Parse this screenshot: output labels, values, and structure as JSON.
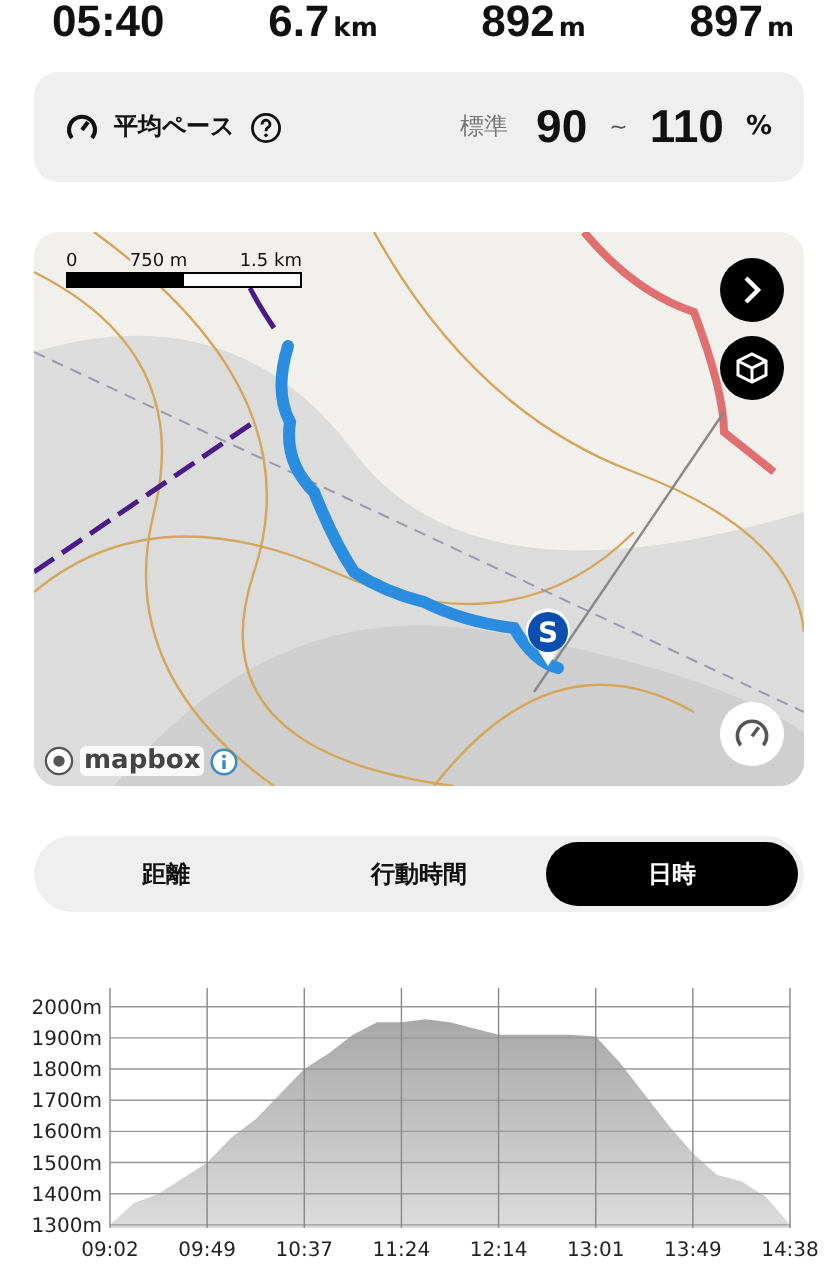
{
  "stats": [
    {
      "value": "05:40"
    },
    {
      "value": "6.7",
      "unit": "km"
    },
    {
      "value": "892",
      "unit": "m"
    },
    {
      "value": "897",
      "unit": "m"
    }
  ],
  "pace": {
    "label": "平均ペース",
    "standard_label": "標準",
    "min": "90",
    "separator": "~",
    "max": "110",
    "unit": "%"
  },
  "map": {
    "kind": "picture",
    "scale": {
      "labels": [
        "0",
        "750 m",
        "1.5 km"
      ]
    },
    "attribution": "mapbox",
    "start_marker": "S"
  },
  "tabs": [
    {
      "label": "距離",
      "selected": false
    },
    {
      "label": "行動時間",
      "selected": false
    },
    {
      "label": "日時",
      "selected": true
    }
  ],
  "chart_data": {
    "type": "area",
    "grid": true,
    "ylim": [
      1290,
      2060
    ],
    "categories": [
      "09:02",
      null,
      null,
      null,
      "09:49",
      null,
      null,
      null,
      "10:37",
      null,
      null,
      null,
      "11:24",
      null,
      null,
      null,
      "12:14",
      null,
      null,
      null,
      "13:01",
      null,
      null,
      null,
      "13:49",
      null,
      null,
      null,
      "14:38"
    ],
    "series": [
      {
        "color": "#a8a8a8",
        "values": [
          1300,
          1370,
          1400,
          1450,
          1500,
          1580,
          1640,
          1720,
          1800,
          1850,
          1910,
          1950,
          1950,
          1960,
          1950,
          1930,
          1910,
          1910,
          1910,
          1910,
          1905,
          1820,
          1720,
          1620,
          1530,
          1460,
          1440,
          1390,
          1300
        ]
      }
    ],
    "yticks": [
      {
        "value": 1300,
        "label": "1300m"
      },
      {
        "value": 1400,
        "label": "1400m"
      },
      {
        "value": 1500,
        "label": "1500m"
      },
      {
        "value": 1600,
        "label": "1600m"
      },
      {
        "value": 1700,
        "label": "1700m"
      },
      {
        "value": 1800,
        "label": "1800m"
      },
      {
        "value": 1900,
        "label": "1900m"
      },
      {
        "value": 2000,
        "label": "2000m"
      }
    ]
  }
}
